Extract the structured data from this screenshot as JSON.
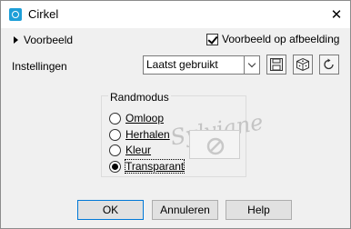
{
  "window": {
    "title": "Cirkel",
    "close_glyph": "✕"
  },
  "preview": {
    "toggle_label": "Voorbeeld",
    "checkbox_label": "Voorbeeld op afbeelding",
    "checked": true
  },
  "settings": {
    "label": "Instellingen",
    "selected": "Laatst gebruikt",
    "tools": [
      "save-icon",
      "randomize-dice-icon",
      "reset-icon"
    ]
  },
  "mode_group": {
    "legend": "Randmodus",
    "options": [
      {
        "label": "Omloop",
        "selected": false
      },
      {
        "label": "Herhalen",
        "selected": false
      },
      {
        "label": "Kleur",
        "selected": false
      },
      {
        "label": "Transparant",
        "selected": true
      }
    ]
  },
  "watermark": {
    "text": "Sylviane"
  },
  "buttons": {
    "ok": "OK",
    "cancel": "Annuleren",
    "help": "Help"
  },
  "colors": {
    "accent": "#0078d7",
    "app_icon": "#1e9fd8",
    "dialog_bg": "#f0f0f0"
  }
}
